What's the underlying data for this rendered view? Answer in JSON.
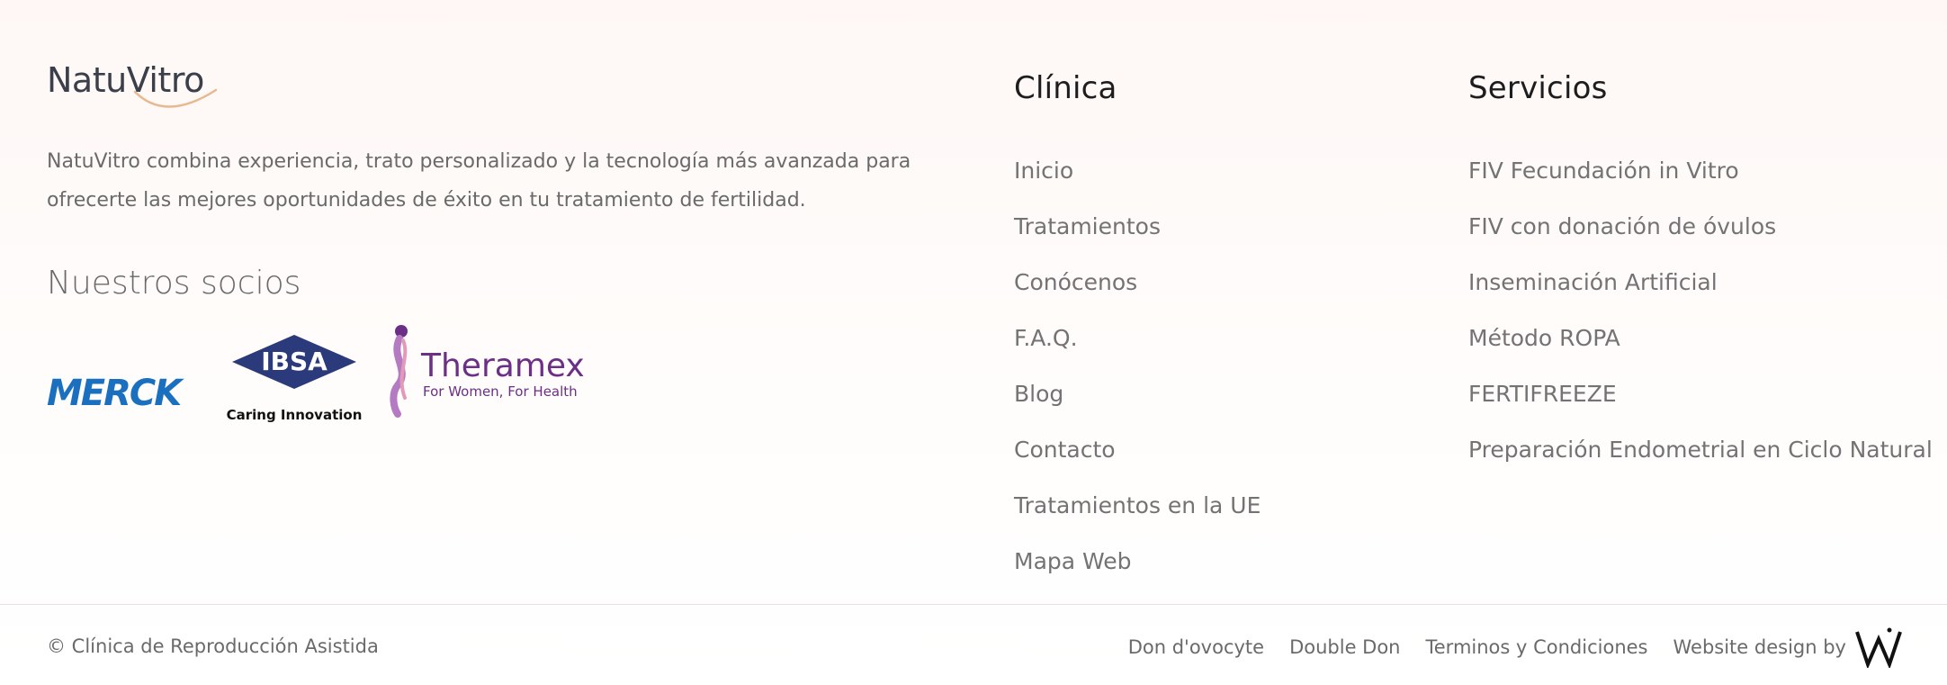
{
  "brand": {
    "logo_text": "NatuVitro",
    "description_line1": "NatuVitro combina experiencia, trato personalizado y la tecnología más avanzada para",
    "description_line2": "ofrecerte las mejores oportunidades de éxito en tu tratamiento de fertilidad.",
    "partners_title": "Nuestros socios",
    "partners": [
      {
        "name": "MERCK",
        "logo_text": "Merck"
      },
      {
        "name": "IBSA",
        "logo_text": "IBSA",
        "tagline": "Caring Innovation"
      },
      {
        "name": "Theramex",
        "logo_text": "Theramex",
        "tagline": "For Women, For Health"
      }
    ]
  },
  "clinica": {
    "title": "Clínica",
    "links": [
      "Inicio",
      "Tratamientos",
      "Conócenos",
      "F.A.Q.",
      "Blog",
      "Contacto",
      "Tratamientos en la UE",
      "Mapa Web"
    ]
  },
  "servicios": {
    "title": "Servicios",
    "links": [
      "FIV Fecundación in Vitro",
      "FIV con donación de óvulos",
      "Inseminación Artificial",
      "Método ROPA",
      "FERTIFREEZE",
      "Preparación Endometrial en Ciclo Natural"
    ]
  },
  "bottom": {
    "copyright": "© Clínica de Reproducción Asistida",
    "legal_links": [
      "Don d'ovocyte",
      "Double Don",
      "Terminos y Condiciones"
    ],
    "design_by": "Website design by"
  },
  "colors": {
    "merck": "#1a6fbf",
    "ibsa": "#2a3a7a",
    "theramex": "#6b2f86",
    "logo_arc": "#e8b98f"
  }
}
